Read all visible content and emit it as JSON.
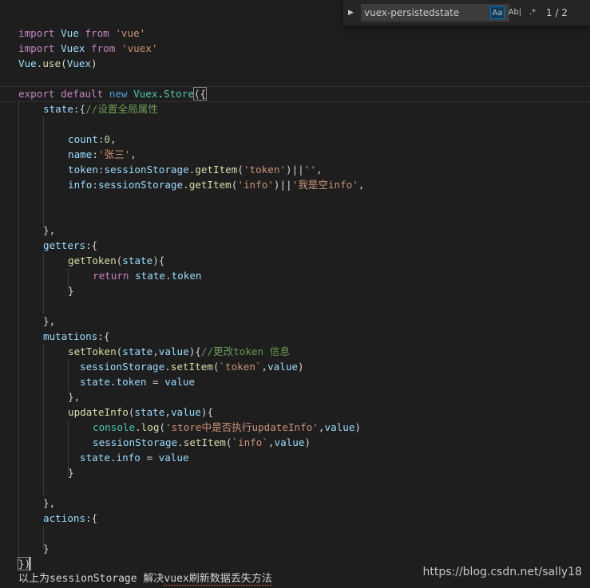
{
  "find_widget": {
    "query": "vuex-persistedstate",
    "match_case_label": "Aa",
    "whole_word_label": "Ab|",
    "regex_label": ".*",
    "match_count": "1 / 2",
    "expand_icon": "chevron-right-icon"
  },
  "code": {
    "l1": {
      "a": "import",
      "b": " Vue ",
      "c": "from",
      "d": " 'vue'"
    },
    "l2": {
      "a": "import",
      "b": " Vuex ",
      "c": "from",
      "d": " 'vuex'"
    },
    "l3": {
      "a": "Vue",
      "b": ".",
      "c": "use",
      "d": "(",
      "e": "Vuex",
      "f": ")"
    },
    "l5": {
      "a": "export",
      "b": " default ",
      "c": "new",
      "d": " Vuex",
      "e": ".",
      "f": "Store",
      "g": "({"
    },
    "l6": {
      "a": "state",
      "b": ":{",
      "c": "//设置全局属性"
    },
    "l8": {
      "a": "count",
      "b": ":",
      "c": "0",
      "d": ","
    },
    "l9": {
      "a": "name",
      "b": ":",
      "c": "'张三'",
      "d": ","
    },
    "l10": {
      "a": "token",
      "b": ":",
      "c": "sessionStorage",
      "d": ".",
      "e": "getItem",
      "f": "(",
      "g": "'token'",
      "h": ")||",
      "i": "''",
      "j": ","
    },
    "l11": {
      "a": "info",
      "b": ":",
      "c": "sessionStorage",
      "d": ".",
      "e": "getItem",
      "f": "(",
      "g": "'info'",
      "h": ")||",
      "i": "'我是空info'",
      "j": ","
    },
    "l14": {
      "a": "},"
    },
    "l15": {
      "a": "getters",
      "b": ":{"
    },
    "l16": {
      "a": "getToken",
      "b": "(",
      "c": "state",
      "d": "){"
    },
    "l17": {
      "a": "return",
      "b": " state",
      "c": ".",
      "d": "token"
    },
    "l18": {
      "a": "}"
    },
    "l20": {
      "a": "},"
    },
    "l21": {
      "a": "mutations",
      "b": ":{"
    },
    "l22": {
      "a": "setToken",
      "b": "(",
      "c": "state",
      "d": ",",
      "e": "value",
      "f": "){",
      "g": "//更改token 信息"
    },
    "l23": {
      "a": "sessionStorage",
      "b": ".",
      "c": "setItem",
      "d": "(",
      "e": "`token`",
      "f": ",",
      "g": "value",
      "h": ")"
    },
    "l24": {
      "a": "state",
      "b": ".",
      "c": "token",
      "d": " = ",
      "e": "value"
    },
    "l25": {
      "a": "},"
    },
    "l26": {
      "a": "updateInfo",
      "b": "(",
      "c": "state",
      "d": ",",
      "e": "value",
      "f": "){"
    },
    "l27": {
      "a": "console",
      "b": ".",
      "c": "log",
      "d": "(",
      "e": "'store中是否执行updateInfo'",
      "f": ",",
      "g": "value",
      "h": ")"
    },
    "l28": {
      "a": "sessionStorage",
      "b": ".",
      "c": "setItem",
      "d": "(",
      "e": "`info`",
      "f": ",",
      "g": "value",
      "h": ")"
    },
    "l29": {
      "a": "state",
      "b": ".",
      "c": "info",
      "d": " = ",
      "e": "value"
    },
    "l30": {
      "a": "}"
    },
    "l32": {
      "a": "},"
    },
    "l33": {
      "a": "actions",
      "b": ":{"
    },
    "l35": {
      "a": "}"
    },
    "l36": {
      "a": "})"
    }
  },
  "footer": {
    "prefix": "以上为",
    "code_word": "sessionStorage",
    "mid": " 解决",
    "squiggle": "vuex刷新数据丢失方法"
  },
  "watermark": "https://blog.csdn.net/sally18",
  "colors": {
    "background": "#1e1e1e",
    "keyword": "#c586c0",
    "storage_keyword": "#569cd6",
    "string": "#ce9178",
    "comment": "#6a9955",
    "property": "#9cdcfe",
    "function": "#dcdcaa",
    "class": "#4ec9b0",
    "number": "#b5cea8",
    "find_active": "#007acc"
  }
}
